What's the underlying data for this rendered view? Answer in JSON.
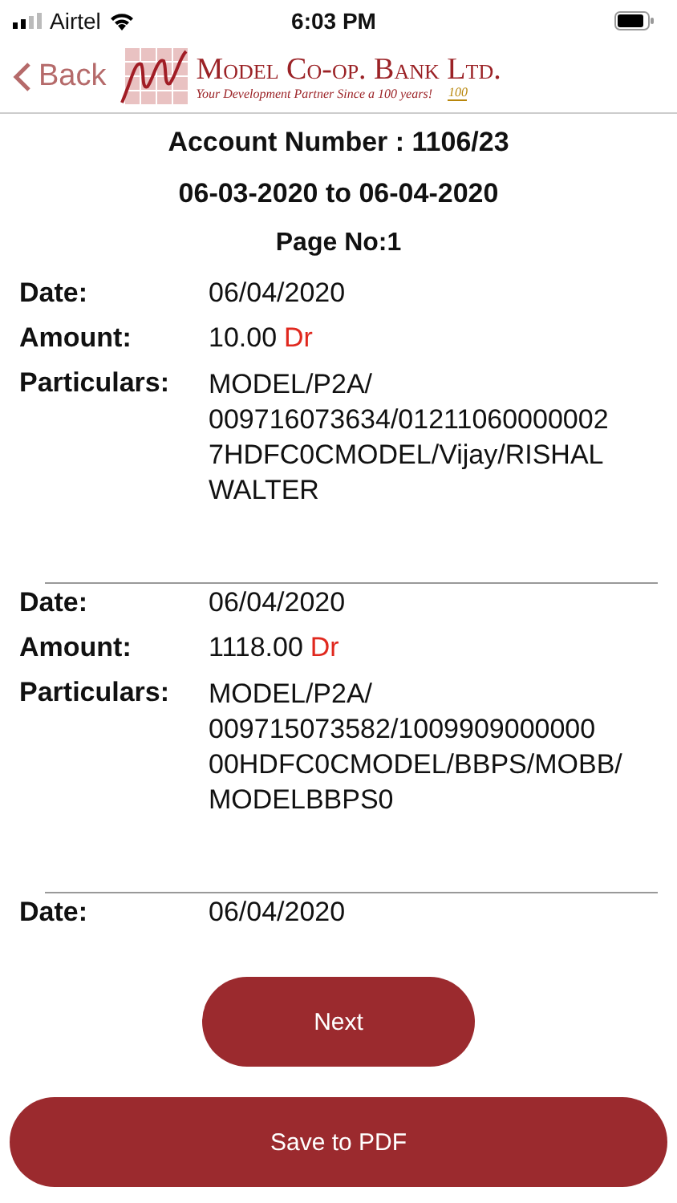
{
  "status_bar": {
    "carrier": "Airtel",
    "time": "6:03 PM"
  },
  "header": {
    "back": "Back",
    "bank_name": "Model Co-op. Bank Ltd.",
    "tagline": "Your Development Partner Since a 100 years!",
    "badge": "100"
  },
  "statement": {
    "account": "Account Number : 1106/23",
    "period": "06-03-2020 to 06-04-2020",
    "page": "Page No:1"
  },
  "entries": [
    {
      "date_label": "Date:",
      "date": "06/04/2020",
      "amount_label": "Amount:",
      "amount": "10.00",
      "type": "Dr",
      "particulars_label": "Particulars:",
      "particulars": [
        "MODEL/P2A/",
        "009716073634/01211060000002",
        "7HDFC0CMODEL/Vijay/RISHAL",
        "WALTER"
      ]
    },
    {
      "date_label": "Date:",
      "date": "06/04/2020",
      "amount_label": "Amount:",
      "amount": "1118.00",
      "type": "Dr",
      "particulars_label": "Particulars:",
      "particulars": [
        "MODEL/P2A/",
        "009715073582/1009909000000",
        "00HDFC0CMODEL/BBPS/MOBB/",
        "MODELBBPS0"
      ]
    },
    {
      "date_label": "Date:",
      "date": "06/04/2020"
    }
  ],
  "buttons": {
    "next": "Next",
    "save": "Save to PDF"
  }
}
